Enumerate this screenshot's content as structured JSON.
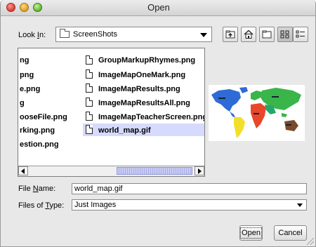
{
  "window": {
    "title": "Open",
    "controls": [
      "close-icon",
      "minimize-icon",
      "zoom-icon"
    ]
  },
  "lookin": {
    "label": "Look In:",
    "value": "ScreenShots",
    "icons": [
      "folder-icon",
      "chevron-down-icon"
    ]
  },
  "toolbar": {
    "buttons": [
      {
        "name": "up-one-level",
        "icon": "up-folder-icon"
      },
      {
        "name": "home",
        "icon": "home-icon"
      },
      {
        "name": "new-folder",
        "icon": "new-folder-icon"
      },
      {
        "name": "list-view",
        "icon": "list-view-icon",
        "pressed": true
      },
      {
        "name": "details-view",
        "icon": "details-view-icon"
      }
    ]
  },
  "files": {
    "column1": [
      "ng",
      "png",
      "e.png",
      "g",
      "ooseFile.png",
      "rking.png",
      "estion.png"
    ],
    "column2": [
      "GroupMarkupRhymes.png",
      "ImageMapOneMark.png",
      "ImageMapResults.png",
      "ImageMapResultsAll.png",
      "ImageMapTeacherScreen.png",
      "world_map.gif"
    ],
    "selected": "world_map.gif"
  },
  "form": {
    "filename_label": "File Name:",
    "filename_value": "world_map.gif",
    "filetype_label": "Files of Type:",
    "filetype_value": "Just Images"
  },
  "buttons": {
    "open": "Open",
    "cancel": "Cancel"
  },
  "colors": {
    "selection": "#d6dafc",
    "scroll_thumb": "#b4b9ec"
  }
}
